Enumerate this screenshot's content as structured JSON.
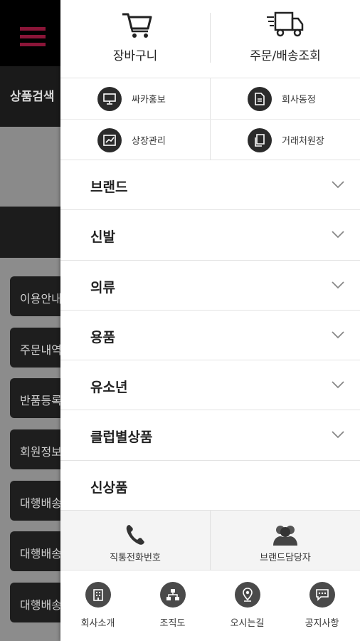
{
  "background": {
    "search_label": "상품검색",
    "buttons": [
      "이용안내",
      "주문내역",
      "반품등록",
      "회원정보",
      "대행배송",
      "대행배송",
      "대행배송"
    ]
  },
  "drawer": {
    "top_actions": [
      {
        "label": "장바구니",
        "icon": "cart-icon"
      },
      {
        "label": "주문/배송조회",
        "icon": "delivery-truck-icon"
      }
    ],
    "grid_links": [
      {
        "label": "싸카홍보",
        "icon": "monitor-icon"
      },
      {
        "label": "회사동정",
        "icon": "document-icon"
      },
      {
        "label": "상장관리",
        "icon": "chart-icon"
      },
      {
        "label": "거래처원장",
        "icon": "ledger-icon"
      }
    ],
    "menu": [
      {
        "label": "브랜드",
        "expandable": true
      },
      {
        "label": "신발",
        "expandable": true
      },
      {
        "label": "의류",
        "expandable": true
      },
      {
        "label": "용품",
        "expandable": true
      },
      {
        "label": "유소년",
        "expandable": true
      },
      {
        "label": "클럽별상품",
        "expandable": true
      },
      {
        "label": "신상품",
        "expandable": false
      }
    ],
    "contacts": [
      {
        "label": "직통전화번호",
        "icon": "phone-icon"
      },
      {
        "label": "브랜드담당자",
        "icon": "people-icon"
      }
    ],
    "bottom_links": [
      {
        "label": "회사소개",
        "icon": "building-icon"
      },
      {
        "label": "조직도",
        "icon": "org-chart-icon"
      },
      {
        "label": "오시는길",
        "icon": "location-pin-icon"
      },
      {
        "label": "공지사항",
        "icon": "chat-bubble-icon"
      }
    ]
  },
  "colors": {
    "header_black": "#000000",
    "hamburger_accent": "#8b1538",
    "icon_dark": "#2b2b2b"
  }
}
